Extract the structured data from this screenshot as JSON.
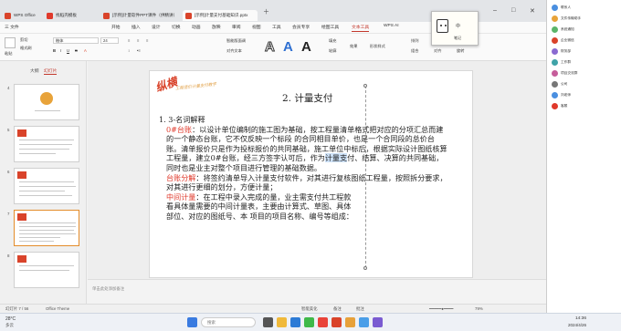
{
  "tabs": [
    {
      "label": "WPS Office",
      "color": "#d9432a"
    },
    {
      "label": "找稻壳模板",
      "color": "#e0392b"
    },
    {
      "label": "[示例]计量软件PPT课件（供精讲）",
      "color": "#d9432a"
    },
    {
      "label": "[示例]计量支付基础知识.pptx",
      "color": "#d9432a"
    }
  ],
  "menu": {
    "file": "三 文件",
    "items": [
      "开始",
      "插入",
      "设计",
      "切换",
      "动画",
      "放映",
      "审阅",
      "视图",
      "工具",
      "会员专享",
      "绘图工具",
      "文本工具",
      "WPS AI"
    ],
    "active": "文本工具"
  },
  "ribbon": {
    "format_painter": "格式刷",
    "paste": "粘贴",
    "cut": "剪切",
    "font_name": "楷体",
    "font_size": "24",
    "text_box": "文本框",
    "textbox_settings": "对齐文本",
    "smart_format": "智能版面调",
    "fill": "填充",
    "outline": "轮廓",
    "text_effect": "效果",
    "shape_style": "形状样式",
    "arrange": "排列",
    "group": "组合",
    "align": "对齐",
    "rotate": "旋转"
  },
  "left_pane": {
    "tabs": [
      "大纲",
      "幻灯片"
    ],
    "active_tab": "幻灯片",
    "slides": [
      4,
      5,
      6,
      7,
      8
    ]
  },
  "slide": {
    "deco_title": "纵横",
    "deco_subtitle": "工程造价计量支付教学",
    "title": "2. 计量支付",
    "heading": "1. 3-名词解释",
    "para1_red": "0#台账",
    "para1": "：以设计单位编制的施工图为基础，按工程量清单格式把对应的分项汇总而建的一个静态台账，它不仅反映一个标段 的合同相目单价，也是一个合同段的总价台账。清单报价只是作为投标报价的共同基础，施工单位中标后，根据实际设计图纸核算工程量，建立0#台账，经三方签字认可后，作为",
    "para1_hl": "计量支",
    "para1_tail": "付、结算、决算的共同基础，同时也是业主对整个项目进行管理的基础数据。",
    "para2_red": "台账分解",
    "para2": "：将签约清单导入计量支付软件，对其进行复核图纸工程量，按照拆分要求，对其进行更细的划分，方便计量；",
    "para3_red": "中间计量",
    "para3": "：在工程中录入完成的量，业主需支付共工程款看具体量需要的中间计量表，主要由计算式、草图、具体部位、对应的图纸号、本 项目的项目名称、编号等组成：",
    "notes_placeholder": "单击此处添加备注"
  },
  "status": {
    "slide_pos": "幻灯片 7 / 56",
    "theme": "Office Theme",
    "smart": "智能美化",
    "notes": "备注",
    "comments": "批注",
    "zoom": "79%"
  },
  "sticky_note": {
    "label": "笔记",
    "text": "中"
  },
  "side_panel": {
    "items": [
      "联系人",
      "文件传输助手",
      "系统通知",
      "企业微信",
      "财务部",
      "工作群",
      "项目交流群",
      "公司",
      "刘老师",
      "客服"
    ]
  },
  "taskbar": {
    "weather_temp": "28°C",
    "weather_desc": "多云",
    "search_placeholder": "搜索",
    "time": "14:36",
    "date": "2024/4/26"
  },
  "colors": {
    "accent": "#c3382c",
    "red_text": "#e0392b",
    "highlight": "#cde1f7",
    "selected_thumb": "#e48c2a"
  }
}
